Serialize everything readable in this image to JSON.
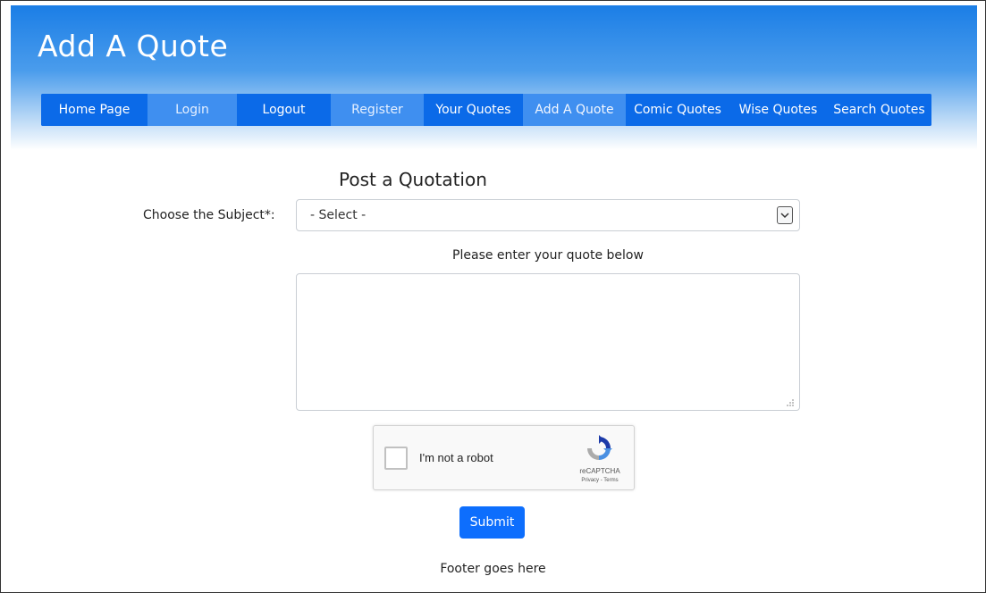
{
  "header": {
    "title": "Add A Quote"
  },
  "navbar": {
    "items": [
      {
        "label": "Home Page"
      },
      {
        "label": "Login"
      },
      {
        "label": "Logout"
      },
      {
        "label": "Register"
      },
      {
        "label": "Your Quotes"
      },
      {
        "label": "Add A Quote"
      },
      {
        "label": "Comic Quotes"
      },
      {
        "label": "Wise Quotes"
      },
      {
        "label": "Search Quotes"
      }
    ],
    "active": "Add A Quote"
  },
  "form": {
    "title": "Post a Quotation",
    "subject_label": "Choose the Subject*:",
    "subject_value": "- Select -",
    "quote_prompt": "Please enter your quote below",
    "quote_value": "",
    "recaptcha_label": "I'm not a robot",
    "recaptcha_brand": "reCAPTCHA",
    "recaptcha_links": "Privacy - Terms",
    "submit_label": "Submit"
  },
  "footer": {
    "text": "Footer goes here"
  },
  "colors": {
    "primary": "#0d6efd",
    "nav_light": "#3f8ff0",
    "header_gradient_top": "#1b7ee6"
  },
  "icons": {
    "select_arrow": "chevron-down-icon",
    "recaptcha_logo": "recaptcha-logo-icon",
    "resize_grip": "resize-grip-icon"
  }
}
